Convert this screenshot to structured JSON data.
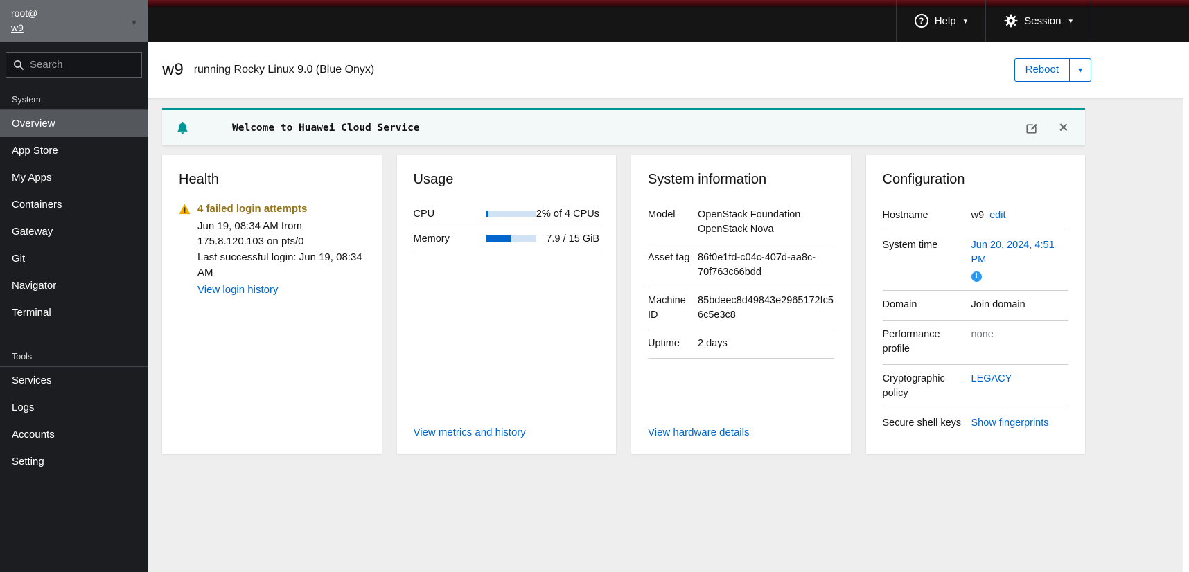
{
  "colors": {
    "accent": "#0066cc",
    "warning_icon": "#f0ab00",
    "warning_text": "#95741c",
    "banner_teal": "#009596",
    "masthead_red": "#661219",
    "sidebar_bg": "#1b1d21"
  },
  "icons": {
    "caret": "▾",
    "close": "✕",
    "question": "?",
    "info": "i"
  },
  "masthead": {
    "account": {
      "user": "root@",
      "host": "w9"
    },
    "help_label": "Help",
    "session_label": "Session"
  },
  "sidebar": {
    "search_placeholder": "Search",
    "sections": [
      {
        "label": "System",
        "items": [
          {
            "label": "Overview",
            "selected": true
          },
          {
            "label": "App Store"
          },
          {
            "label": "My Apps"
          },
          {
            "label": "Containers"
          },
          {
            "label": "Gateway"
          },
          {
            "label": "Git"
          },
          {
            "label": "Navigator"
          },
          {
            "label": "Terminal"
          }
        ]
      },
      {
        "label": "Tools",
        "items": [
          {
            "label": "Services"
          },
          {
            "label": "Logs"
          },
          {
            "label": "Accounts"
          },
          {
            "label": "Setting"
          }
        ]
      }
    ]
  },
  "header": {
    "hostname": "w9",
    "subtitle": "running Rocky Linux 9.0 (Blue Onyx)",
    "reboot_label": "Reboot"
  },
  "banner": {
    "message": "Welcome to Huawei Cloud Service"
  },
  "cards": {
    "health": {
      "title": "Health",
      "warning_title": "4 failed login attempts",
      "warning_detail": "Jun 19, 08:34 AM from 175.8.120.103 on pts/0",
      "last_login": "Last successful login: Jun 19, 08:34 AM",
      "link": "View login history"
    },
    "usage": {
      "title": "Usage",
      "rows": [
        {
          "label": "CPU",
          "percent": 6,
          "value": "2% of 4 CPUs"
        },
        {
          "label": "Memory",
          "percent": 52,
          "value": "7.9 / 15 GiB"
        }
      ],
      "link": "View metrics and history"
    },
    "system_information": {
      "title": "System information",
      "rows": [
        {
          "label": "Model",
          "value": "OpenStack Foundation OpenStack Nova"
        },
        {
          "label": "Asset tag",
          "value": "86f0e1fd-c04c-407d-aa8c-70f763c66bdd"
        },
        {
          "label": "Machine ID",
          "value": "85bdeec8d49843e2965172fc56c5e3c8"
        },
        {
          "label": "Uptime",
          "value": "2 days"
        }
      ],
      "link": "View hardware details"
    },
    "configuration": {
      "title": "Configuration",
      "rows": [
        {
          "label": "Hostname",
          "value": "w9",
          "link": "edit"
        },
        {
          "label": "System time",
          "link": "Jun 20, 2024, 4:51 PM"
        },
        {
          "label": "Domain",
          "value": "Join domain"
        },
        {
          "label": "Performance profile",
          "value": "none"
        },
        {
          "label": "Cryptographic policy",
          "link": "LEGACY"
        },
        {
          "label": "Secure shell keys",
          "link": "Show fingerprints"
        }
      ]
    }
  }
}
